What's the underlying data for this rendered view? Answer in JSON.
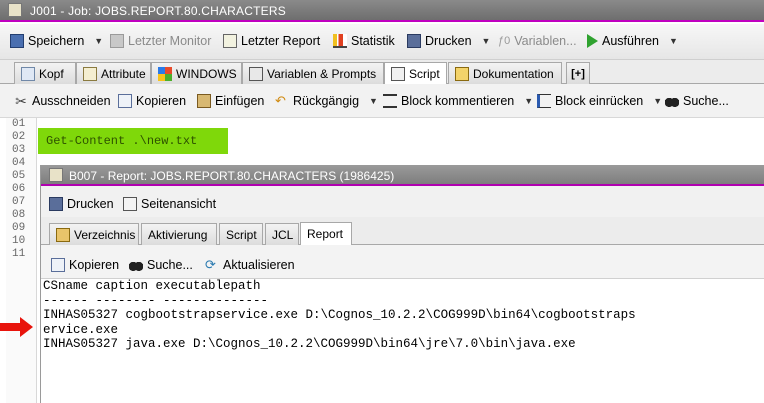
{
  "window": {
    "title": "J001 - Job: JOBS.REPORT.80.CHARACTERS"
  },
  "toolbar": {
    "save": "Speichern",
    "last_monitor": "Letzter Monitor",
    "last_report": "Letzter Report",
    "statistics": "Statistik",
    "print": "Drucken",
    "variables": "Variablen...",
    "run": "Ausführen"
  },
  "tabs": [
    "Kopf",
    "Attribute",
    "WINDOWS",
    "Variablen & Prompts",
    "Script",
    "Dokumentation"
  ],
  "active_tab": "Script",
  "add_tab_symbol": "[+]",
  "editor_toolbar": {
    "cut": "Ausschneiden",
    "copy": "Kopieren",
    "paste": "Einfügen",
    "undo": "Rückgängig",
    "comment_block": "Block kommentieren",
    "indent_block": "Block einrücken",
    "search": "Suche..."
  },
  "editor": {
    "line_numbers": [
      "01",
      "02",
      "03",
      "04",
      "05",
      "06",
      "07",
      "08",
      "09",
      "10",
      "11"
    ],
    "highlighted_line": "Get-Content .\\new.txt"
  },
  "report_window": {
    "title": "B007 - Report: JOBS.REPORT.80.CHARACTERS (1986425)",
    "print": "Drucken",
    "page_view": "Seitenansicht",
    "tabs": [
      "Verzeichnis",
      "Aktivierung",
      "Script",
      "JCL",
      "Report"
    ],
    "active_tab": "Report",
    "copy": "Kopieren",
    "search": "Suche...",
    "refresh": "Aktualisieren",
    "output_lines": [
      "CSname caption executablepath",
      "------ -------- --------------",
      "INHAS05327 cogbootstrapservice.exe D:\\Cognos_10.2.2\\COG999D\\bin64\\cogbootstraps",
      "ervice.exe",
      "INHAS05327 java.exe D:\\Cognos_10.2.2\\COG999D\\bin64\\jre\\7.0\\bin\\java.exe"
    ]
  },
  "colors": {
    "highlight_green": "#7fd80a",
    "arrow_red": "#e8140c",
    "title_accent": "#c000c0"
  }
}
